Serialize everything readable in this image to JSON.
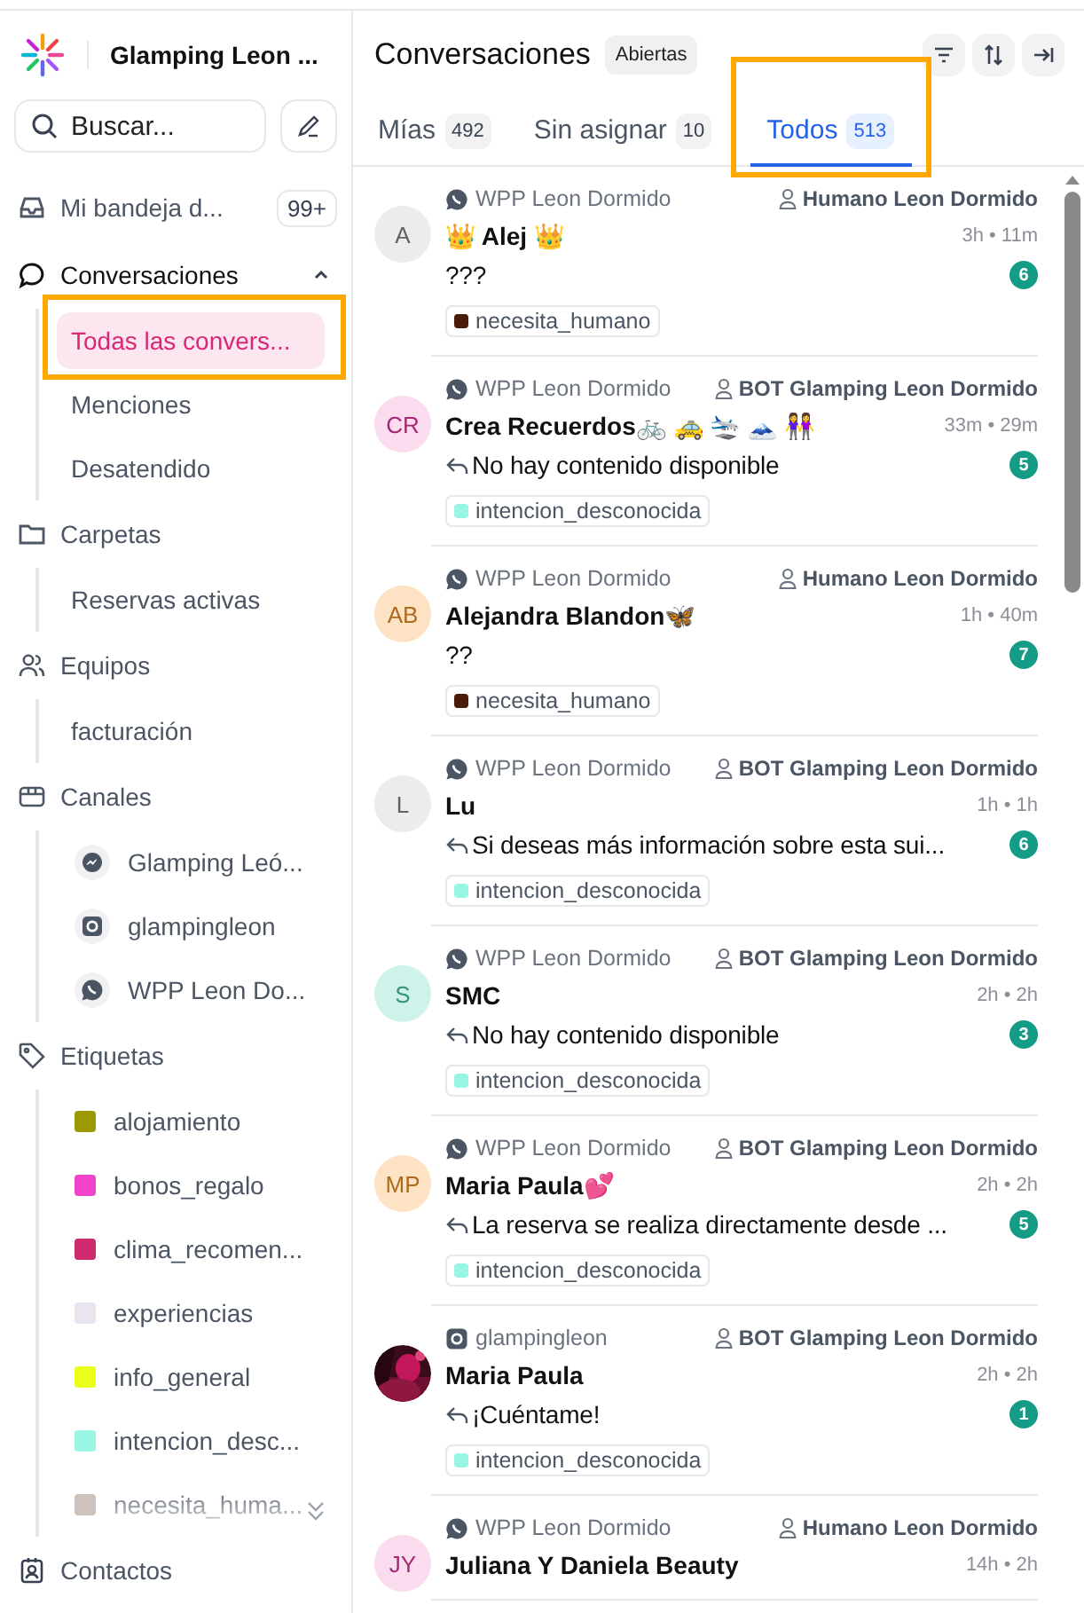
{
  "workspace": {
    "name": "Glamping Leon ..."
  },
  "search": {
    "placeholder": "Buscar..."
  },
  "nav": [
    {
      "label": "Mi bandeja d...",
      "badge": "99+"
    },
    {
      "label": "Conversaciones",
      "expanded": true,
      "children": [
        {
          "label": "Todas las convers...",
          "selected": true,
          "highlighted": true
        },
        {
          "label": "Menciones",
          "selected": false,
          "highlighted": false
        },
        {
          "label": "Desatendido",
          "selected": false,
          "highlighted": false
        }
      ]
    },
    {
      "label": "Carpetas",
      "children": [
        {
          "label": "Reservas activas",
          "selected": false,
          "highlighted": false
        }
      ]
    },
    {
      "label": "Equipos",
      "children": [
        {
          "label": "facturación",
          "selected": false,
          "highlighted": false
        }
      ]
    },
    {
      "label": "Canales",
      "children": [
        {
          "label": "Glamping Leó...",
          "kind": "messenger",
          "selected": false,
          "highlighted": false
        },
        {
          "label": "glampingleon",
          "kind": "instagram",
          "selected": false,
          "highlighted": false
        },
        {
          "label": "WPP Leon Do...",
          "kind": "whatsapp",
          "selected": false,
          "highlighted": false
        }
      ]
    },
    {
      "label": "Etiquetas",
      "children": [
        {
          "label": "alojamiento",
          "kind": "label",
          "color": "#9c9800",
          "selected": false,
          "highlighted": false
        },
        {
          "label": "bonos_regalo",
          "kind": "label",
          "color": "#f044c8",
          "selected": false,
          "highlighted": false
        },
        {
          "label": "clima_recomen...",
          "kind": "label",
          "color": "#cf2b6c",
          "selected": false,
          "highlighted": false
        },
        {
          "label": "experiencias",
          "kind": "label",
          "color": "#ebe4ee",
          "selected": false,
          "highlighted": false
        },
        {
          "label": "info_general",
          "kind": "label",
          "color": "#eaff1a",
          "selected": false,
          "highlighted": false
        },
        {
          "label": "intencion_desc...",
          "kind": "label",
          "color": "#99f6e4",
          "selected": false,
          "highlighted": false
        },
        {
          "label": "necesita_huma...",
          "kind": "label",
          "color": "#ccc3bf",
          "selected": false,
          "highlighted": false
        }
      ]
    },
    {
      "label": "Contactos"
    }
  ],
  "header": {
    "title": "Conversaciones",
    "status": "Abiertas"
  },
  "tabs": [
    {
      "label": "Mías",
      "count": "492",
      "selected": false
    },
    {
      "label": "Sin asignar",
      "count": "10",
      "selected": false
    },
    {
      "label": "Todos",
      "count": "513",
      "selected": true,
      "highlighted": true
    }
  ],
  "conversations": [
    {
      "channel": {
        "kind": "whatsapp",
        "name": "WPP Leon Dormido"
      },
      "assignee": "Humano Leon Dormido",
      "avatar": {
        "kind": "initials",
        "initials": "A",
        "color": "#ececec"
      },
      "name": "👑 Alej 👑",
      "time": "3h • 11m",
      "reply": false,
      "message": "???",
      "unread": "6",
      "tag": {
        "label": "necesita_humano",
        "color": "#4a1a0a"
      }
    },
    {
      "channel": {
        "kind": "whatsapp",
        "name": "WPP Leon Dormido"
      },
      "assignee": "BOT Glamping Leon Dormido",
      "avatar": {
        "kind": "initials",
        "initials": "CR",
        "color": "#fbdcef"
      },
      "name": "Crea Recuerdos🚲 🚕 🛬 🗻 👭",
      "time": "33m • 29m",
      "reply": true,
      "message": "No hay contenido disponible",
      "unread": "5",
      "tag": {
        "label": "intencion_desconocida",
        "color": "#99f6e4"
      }
    },
    {
      "channel": {
        "kind": "whatsapp",
        "name": "WPP Leon Dormido"
      },
      "assignee": "Humano Leon Dormido",
      "avatar": {
        "kind": "initials",
        "initials": "AB",
        "color": "#fde2c3"
      },
      "name": "Alejandra Blandon🦋",
      "time": "1h • 40m",
      "reply": false,
      "message": "??",
      "unread": "7",
      "tag": {
        "label": "necesita_humano",
        "color": "#4a1a0a"
      }
    },
    {
      "channel": {
        "kind": "whatsapp",
        "name": "WPP Leon Dormido"
      },
      "assignee": "BOT Glamping Leon Dormido",
      "avatar": {
        "kind": "initials",
        "initials": "L",
        "color": "#ececec"
      },
      "name": "Lu",
      "time": "1h • 1h",
      "reply": true,
      "message": "Si deseas más información sobre esta sui...",
      "unread": "6",
      "tag": {
        "label": "intencion_desconocida",
        "color": "#99f6e4"
      }
    },
    {
      "channel": {
        "kind": "whatsapp",
        "name": "WPP Leon Dormido"
      },
      "assignee": "BOT Glamping Leon Dormido",
      "avatar": {
        "kind": "initials",
        "initials": "S",
        "color": "#cff3ea"
      },
      "name": "SMC",
      "time": "2h • 2h",
      "reply": true,
      "message": "No hay contenido disponible",
      "unread": "3",
      "tag": {
        "label": "intencion_desconocida",
        "color": "#99f6e4"
      }
    },
    {
      "channel": {
        "kind": "whatsapp",
        "name": "WPP Leon Dormido"
      },
      "assignee": "BOT Glamping Leon Dormido",
      "avatar": {
        "kind": "initials",
        "initials": "MP",
        "color": "#fde2c3"
      },
      "name": "Maria Paula💕",
      "time": "2h • 2h",
      "reply": true,
      "message": "La reserva se realiza directamente desde ...",
      "unread": "5",
      "tag": {
        "label": "intencion_desconocida",
        "color": "#99f6e4"
      }
    },
    {
      "channel": {
        "kind": "instagram",
        "name": "glampingleon"
      },
      "assignee": "BOT Glamping Leon Dormido",
      "name": "Maria Paula",
      "time": "2h • 2h",
      "reply": true,
      "message": "¡Cuéntame!",
      "unread": "1",
      "tag": {
        "label": "intencion_desconocida",
        "color": "#99f6e4"
      }
    },
    {
      "channel": {
        "kind": "whatsapp",
        "name": "WPP Leon Dormido"
      },
      "assignee": "Humano Leon Dormido",
      "avatar": {
        "kind": "initials",
        "initials": "JY",
        "color": "#fbdcef"
      },
      "name": "Juliana Y Daniela Beauty",
      "time": "14h • 2h"
    }
  ]
}
